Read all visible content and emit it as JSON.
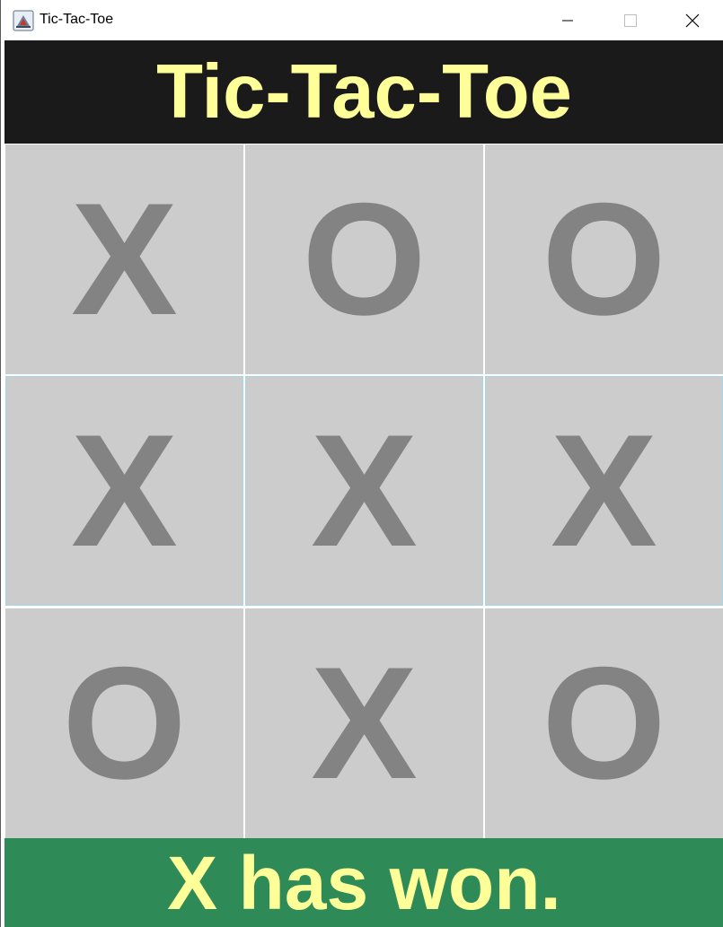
{
  "window": {
    "title": "Tic-Tac-Toe",
    "app_icon": "java-app-icon",
    "controls": [
      "minimize-icon",
      "maximize-icon",
      "close-icon"
    ]
  },
  "header": {
    "title": "Tic-Tac-Toe"
  },
  "board": {
    "cells": [
      "X",
      "O",
      "O",
      "X",
      "X",
      "X",
      "O",
      "X",
      "O"
    ]
  },
  "status": {
    "message": "X has won."
  },
  "colors": {
    "header_bg": "#1a1a1a",
    "title_text": "#ffff99",
    "cell_bg": "#cccccc",
    "mark_text": "#838383",
    "status_bg": "#2e8b57"
  }
}
